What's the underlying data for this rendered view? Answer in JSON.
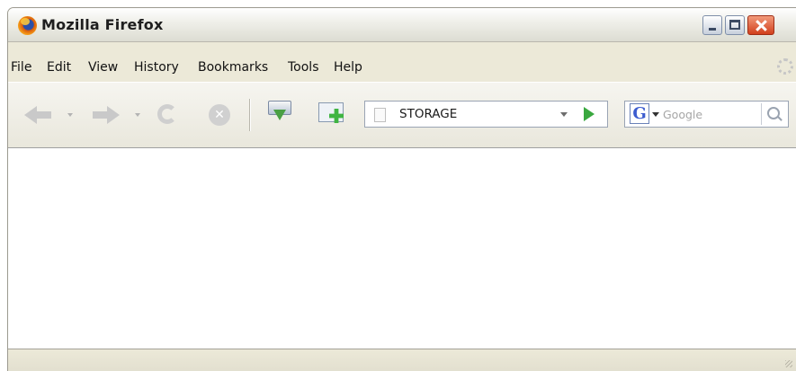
{
  "window": {
    "title": "Mozilla Firefox"
  },
  "menubar": {
    "items": [
      "File",
      "Edit",
      "View",
      "History",
      "Bookmarks",
      "Tools",
      "Help"
    ]
  },
  "toolbar": {
    "icons": [
      "back-arrow-icon",
      "forward-arrow-icon",
      "reload-icon",
      "stop-icon",
      "download-icon",
      "add-bookmark-icon"
    ],
    "stop_glyph": "✕"
  },
  "urlbar": {
    "value": "STORAGE"
  },
  "search": {
    "engine_letter": "G",
    "placeholder": "Google"
  },
  "colors": {
    "window_bg": "#ece9d8",
    "close_button": "#d1401d",
    "go_arrow": "#3aa83f"
  }
}
